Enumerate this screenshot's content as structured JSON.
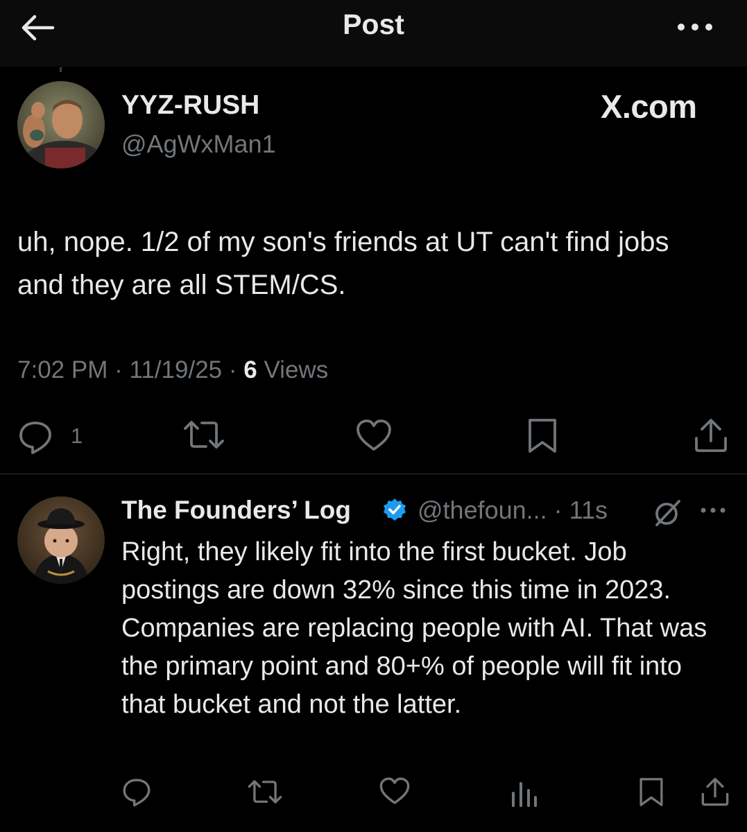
{
  "header": {
    "title": "Post",
    "icons": {
      "back": "arrow-left-icon",
      "more": "more-horizontal-icon"
    }
  },
  "main_post": {
    "author_name": "YYZ-RUSH",
    "author_handle": "@AgWxMan1",
    "watermark": "X.com",
    "text": "uh, nope.  1/2 of my son's friends at UT can't find jobs and they are all STEM/CS.",
    "time": "7:02 PM",
    "date": "11/19/25",
    "views_count": "6",
    "views_label": "Views",
    "reply_count": "1",
    "icons": [
      "reply-icon",
      "retweet-icon",
      "heart-icon",
      "bookmark-icon",
      "share-icon"
    ]
  },
  "reply_post": {
    "author_name": "The Founders’ Log",
    "author_handle": "@thefoun...",
    "time_ago": "11s",
    "verified_color": "#1d9bf0",
    "text": "Right, they likely fit into the first bucket. Job postings are down 32% since this time in 2023. Companies are replacing people with AI. That was the primary point and 80+% of people will fit into that bucket and not the latter.",
    "icons": [
      "reply-icon",
      "retweet-icon",
      "heart-icon",
      "views-icon",
      "bookmark-icon",
      "share-icon"
    ]
  },
  "colors": {
    "background": "#000000",
    "text_primary": "#e7e9ea",
    "text_secondary": "#71767b",
    "divider": "#2f3336"
  }
}
